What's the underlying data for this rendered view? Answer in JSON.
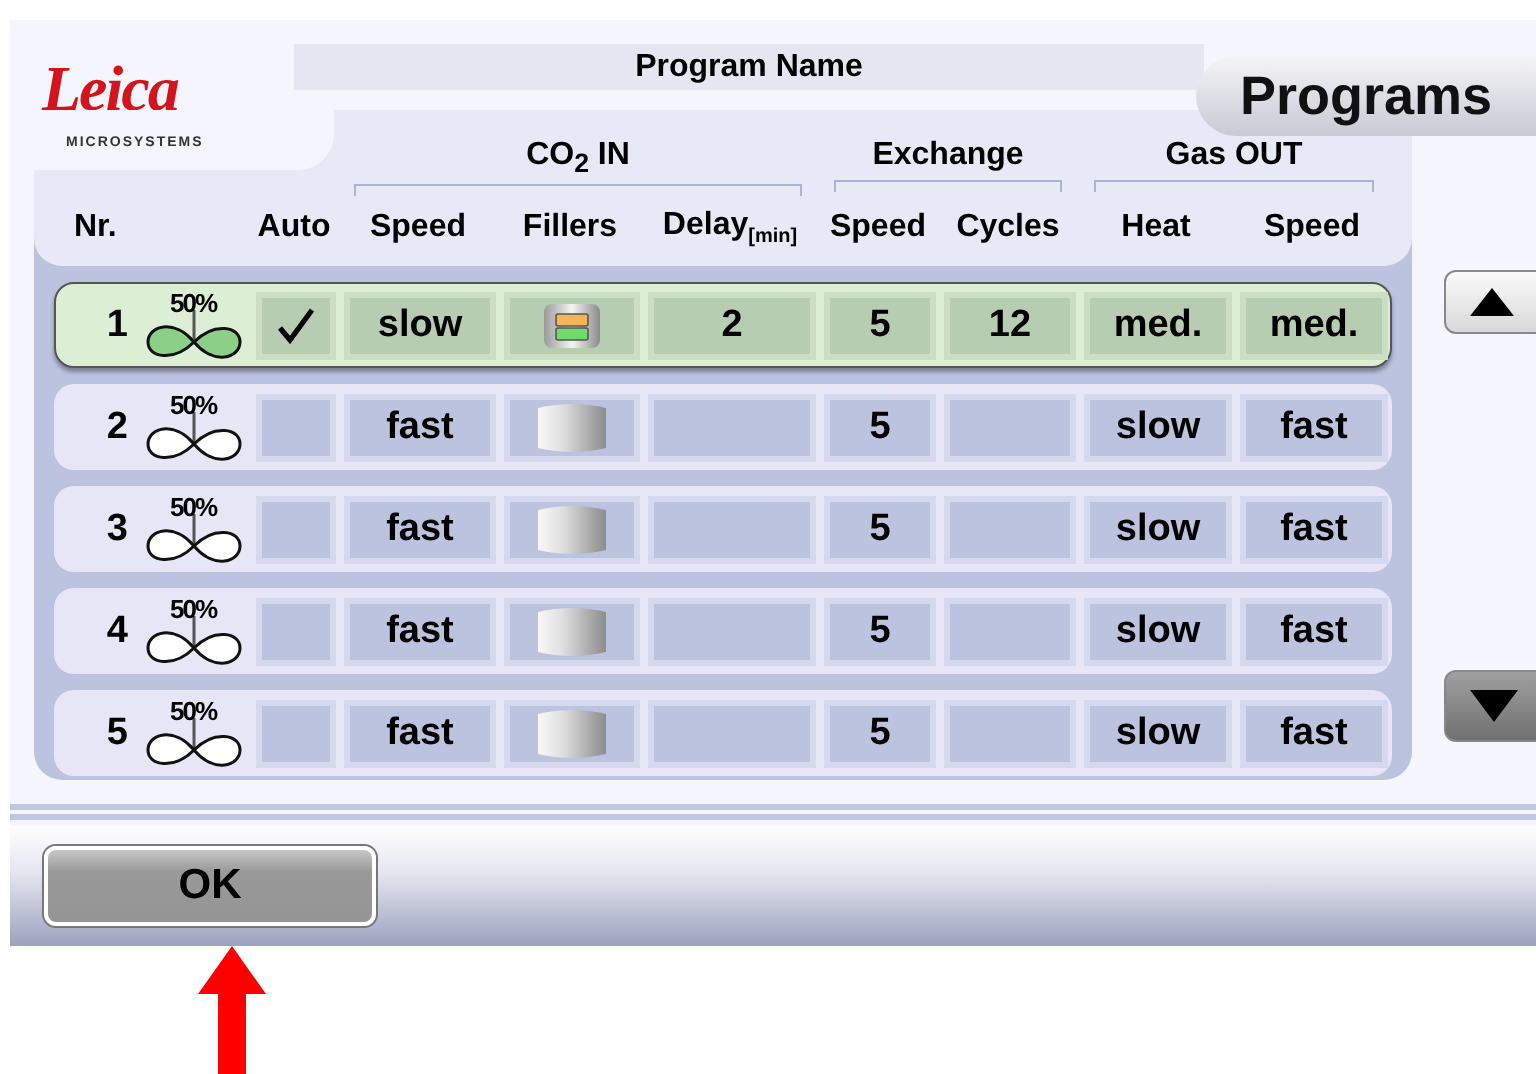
{
  "logo": {
    "wordmark": "Leica",
    "tagline": "MICROSYSTEMS"
  },
  "program_name": "Program Name",
  "title_tab": "Programs",
  "column_groups": [
    {
      "label": "CO$_{2}$ IN"
    },
    {
      "label": "Exchange"
    },
    {
      "label": "Gas OUT"
    }
  ],
  "columns": [
    "Nr.",
    "Auto",
    "Speed",
    "Fillers",
    "Delay$_{[min]}$",
    "Speed",
    "Cycles",
    "Heat",
    "Speed"
  ],
  "rows": [
    {
      "nr": "1",
      "fan_label": "50%",
      "selected": true,
      "auto": true,
      "speed": "slow",
      "fillers_loaded": true,
      "delay": "2",
      "exchange_speed": "5",
      "cycles": "12",
      "heat": "med.",
      "gas_speed": "med."
    },
    {
      "nr": "2",
      "fan_label": "50%",
      "selected": false,
      "auto": false,
      "speed": "fast",
      "fillers_loaded": false,
      "exchange_speed": "5",
      "heat": "slow",
      "gas_speed": "fast"
    },
    {
      "nr": "3",
      "fan_label": "50%",
      "selected": false,
      "auto": false,
      "speed": "fast",
      "fillers_loaded": false,
      "exchange_speed": "5",
      "heat": "slow",
      "gas_speed": "fast"
    },
    {
      "nr": "4",
      "fan_label": "50%",
      "selected": false,
      "auto": false,
      "speed": "fast",
      "fillers_loaded": false,
      "exchange_speed": "5",
      "heat": "slow",
      "gas_speed": "fast"
    },
    {
      "nr": "5",
      "fan_label": "50%",
      "selected": false,
      "auto": false,
      "speed": "fast",
      "fillers_loaded": false,
      "exchange_speed": "5",
      "heat": "slow",
      "gas_speed": "fast"
    }
  ],
  "ok_button": "OK"
}
